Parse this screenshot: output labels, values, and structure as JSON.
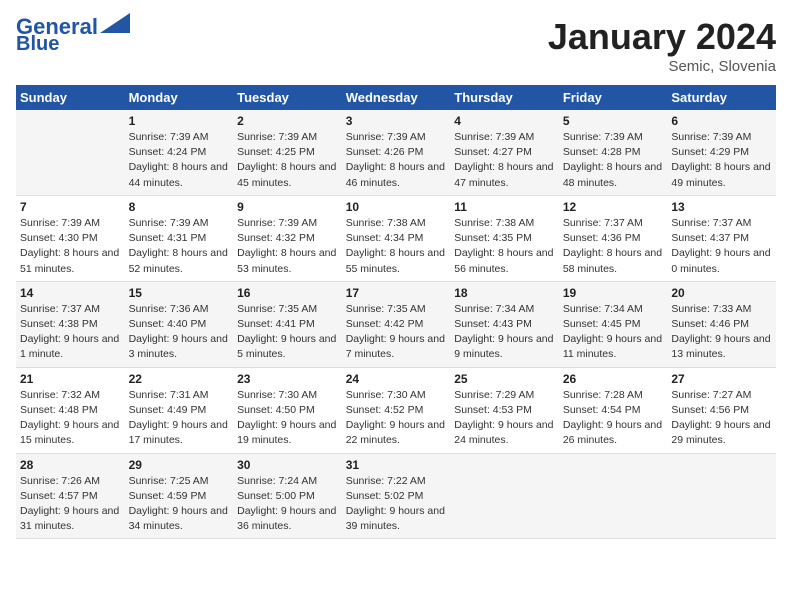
{
  "header": {
    "logo_line1": "General",
    "logo_line2": "Blue",
    "month": "January 2024",
    "location": "Semic, Slovenia"
  },
  "columns": [
    "Sunday",
    "Monday",
    "Tuesday",
    "Wednesday",
    "Thursday",
    "Friday",
    "Saturday"
  ],
  "weeks": [
    [
      {
        "day": "",
        "sunrise": "",
        "sunset": "",
        "daylight": ""
      },
      {
        "day": "1",
        "sunrise": "Sunrise: 7:39 AM",
        "sunset": "Sunset: 4:24 PM",
        "daylight": "Daylight: 8 hours and 44 minutes."
      },
      {
        "day": "2",
        "sunrise": "Sunrise: 7:39 AM",
        "sunset": "Sunset: 4:25 PM",
        "daylight": "Daylight: 8 hours and 45 minutes."
      },
      {
        "day": "3",
        "sunrise": "Sunrise: 7:39 AM",
        "sunset": "Sunset: 4:26 PM",
        "daylight": "Daylight: 8 hours and 46 minutes."
      },
      {
        "day": "4",
        "sunrise": "Sunrise: 7:39 AM",
        "sunset": "Sunset: 4:27 PM",
        "daylight": "Daylight: 8 hours and 47 minutes."
      },
      {
        "day": "5",
        "sunrise": "Sunrise: 7:39 AM",
        "sunset": "Sunset: 4:28 PM",
        "daylight": "Daylight: 8 hours and 48 minutes."
      },
      {
        "day": "6",
        "sunrise": "Sunrise: 7:39 AM",
        "sunset": "Sunset: 4:29 PM",
        "daylight": "Daylight: 8 hours and 49 minutes."
      }
    ],
    [
      {
        "day": "7",
        "sunrise": "Sunrise: 7:39 AM",
        "sunset": "Sunset: 4:30 PM",
        "daylight": "Daylight: 8 hours and 51 minutes."
      },
      {
        "day": "8",
        "sunrise": "Sunrise: 7:39 AM",
        "sunset": "Sunset: 4:31 PM",
        "daylight": "Daylight: 8 hours and 52 minutes."
      },
      {
        "day": "9",
        "sunrise": "Sunrise: 7:39 AM",
        "sunset": "Sunset: 4:32 PM",
        "daylight": "Daylight: 8 hours and 53 minutes."
      },
      {
        "day": "10",
        "sunrise": "Sunrise: 7:38 AM",
        "sunset": "Sunset: 4:34 PM",
        "daylight": "Daylight: 8 hours and 55 minutes."
      },
      {
        "day": "11",
        "sunrise": "Sunrise: 7:38 AM",
        "sunset": "Sunset: 4:35 PM",
        "daylight": "Daylight: 8 hours and 56 minutes."
      },
      {
        "day": "12",
        "sunrise": "Sunrise: 7:37 AM",
        "sunset": "Sunset: 4:36 PM",
        "daylight": "Daylight: 8 hours and 58 minutes."
      },
      {
        "day": "13",
        "sunrise": "Sunrise: 7:37 AM",
        "sunset": "Sunset: 4:37 PM",
        "daylight": "Daylight: 9 hours and 0 minutes."
      }
    ],
    [
      {
        "day": "14",
        "sunrise": "Sunrise: 7:37 AM",
        "sunset": "Sunset: 4:38 PM",
        "daylight": "Daylight: 9 hours and 1 minute."
      },
      {
        "day": "15",
        "sunrise": "Sunrise: 7:36 AM",
        "sunset": "Sunset: 4:40 PM",
        "daylight": "Daylight: 9 hours and 3 minutes."
      },
      {
        "day": "16",
        "sunrise": "Sunrise: 7:35 AM",
        "sunset": "Sunset: 4:41 PM",
        "daylight": "Daylight: 9 hours and 5 minutes."
      },
      {
        "day": "17",
        "sunrise": "Sunrise: 7:35 AM",
        "sunset": "Sunset: 4:42 PM",
        "daylight": "Daylight: 9 hours and 7 minutes."
      },
      {
        "day": "18",
        "sunrise": "Sunrise: 7:34 AM",
        "sunset": "Sunset: 4:43 PM",
        "daylight": "Daylight: 9 hours and 9 minutes."
      },
      {
        "day": "19",
        "sunrise": "Sunrise: 7:34 AM",
        "sunset": "Sunset: 4:45 PM",
        "daylight": "Daylight: 9 hours and 11 minutes."
      },
      {
        "day": "20",
        "sunrise": "Sunrise: 7:33 AM",
        "sunset": "Sunset: 4:46 PM",
        "daylight": "Daylight: 9 hours and 13 minutes."
      }
    ],
    [
      {
        "day": "21",
        "sunrise": "Sunrise: 7:32 AM",
        "sunset": "Sunset: 4:48 PM",
        "daylight": "Daylight: 9 hours and 15 minutes."
      },
      {
        "day": "22",
        "sunrise": "Sunrise: 7:31 AM",
        "sunset": "Sunset: 4:49 PM",
        "daylight": "Daylight: 9 hours and 17 minutes."
      },
      {
        "day": "23",
        "sunrise": "Sunrise: 7:30 AM",
        "sunset": "Sunset: 4:50 PM",
        "daylight": "Daylight: 9 hours and 19 minutes."
      },
      {
        "day": "24",
        "sunrise": "Sunrise: 7:30 AM",
        "sunset": "Sunset: 4:52 PM",
        "daylight": "Daylight: 9 hours and 22 minutes."
      },
      {
        "day": "25",
        "sunrise": "Sunrise: 7:29 AM",
        "sunset": "Sunset: 4:53 PM",
        "daylight": "Daylight: 9 hours and 24 minutes."
      },
      {
        "day": "26",
        "sunrise": "Sunrise: 7:28 AM",
        "sunset": "Sunset: 4:54 PM",
        "daylight": "Daylight: 9 hours and 26 minutes."
      },
      {
        "day": "27",
        "sunrise": "Sunrise: 7:27 AM",
        "sunset": "Sunset: 4:56 PM",
        "daylight": "Daylight: 9 hours and 29 minutes."
      }
    ],
    [
      {
        "day": "28",
        "sunrise": "Sunrise: 7:26 AM",
        "sunset": "Sunset: 4:57 PM",
        "daylight": "Daylight: 9 hours and 31 minutes."
      },
      {
        "day": "29",
        "sunrise": "Sunrise: 7:25 AM",
        "sunset": "Sunset: 4:59 PM",
        "daylight": "Daylight: 9 hours and 34 minutes."
      },
      {
        "day": "30",
        "sunrise": "Sunrise: 7:24 AM",
        "sunset": "Sunset: 5:00 PM",
        "daylight": "Daylight: 9 hours and 36 minutes."
      },
      {
        "day": "31",
        "sunrise": "Sunrise: 7:22 AM",
        "sunset": "Sunset: 5:02 PM",
        "daylight": "Daylight: 9 hours and 39 minutes."
      },
      {
        "day": "",
        "sunrise": "",
        "sunset": "",
        "daylight": ""
      },
      {
        "day": "",
        "sunrise": "",
        "sunset": "",
        "daylight": ""
      },
      {
        "day": "",
        "sunrise": "",
        "sunset": "",
        "daylight": ""
      }
    ]
  ]
}
